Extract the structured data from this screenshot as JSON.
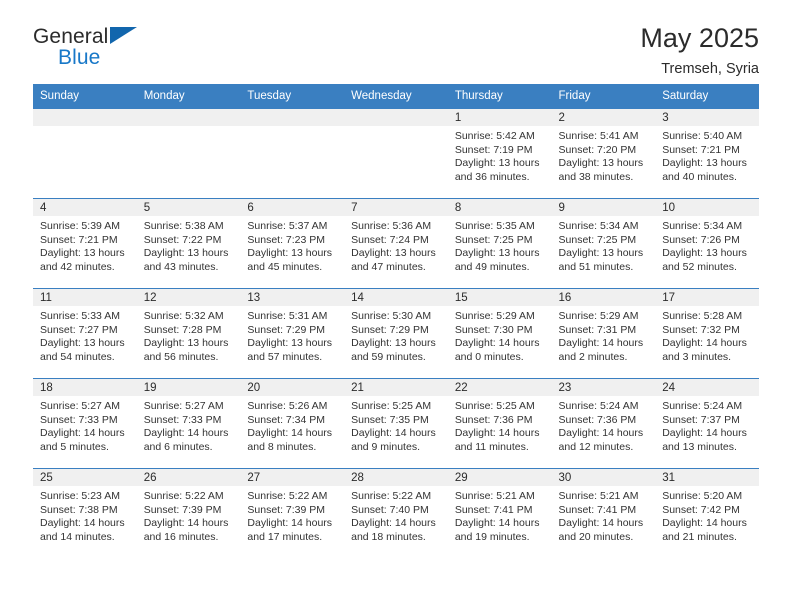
{
  "brand": {
    "word_one": "General",
    "word_two": "Blue",
    "flag_icon": "triangle-flag-icon"
  },
  "header": {
    "title": "May 2025",
    "location": "Tremseh, Syria"
  },
  "calendar": {
    "weekday_headers": [
      "Sunday",
      "Monday",
      "Tuesday",
      "Wednesday",
      "Thursday",
      "Friday",
      "Saturday"
    ],
    "accent_color": "#3a7fc1",
    "daynum_band_color": "#f0f0f0",
    "weeks": [
      [
        {
          "day": "",
          "sunrise": "",
          "sunset": "",
          "daylight_line1": "",
          "daylight_line2": ""
        },
        {
          "day": "",
          "sunrise": "",
          "sunset": "",
          "daylight_line1": "",
          "daylight_line2": ""
        },
        {
          "day": "",
          "sunrise": "",
          "sunset": "",
          "daylight_line1": "",
          "daylight_line2": ""
        },
        {
          "day": "",
          "sunrise": "",
          "sunset": "",
          "daylight_line1": "",
          "daylight_line2": ""
        },
        {
          "day": "1",
          "sunrise": "Sunrise: 5:42 AM",
          "sunset": "Sunset: 7:19 PM",
          "daylight_line1": "Daylight: 13 hours",
          "daylight_line2": "and 36 minutes."
        },
        {
          "day": "2",
          "sunrise": "Sunrise: 5:41 AM",
          "sunset": "Sunset: 7:20 PM",
          "daylight_line1": "Daylight: 13 hours",
          "daylight_line2": "and 38 minutes."
        },
        {
          "day": "3",
          "sunrise": "Sunrise: 5:40 AM",
          "sunset": "Sunset: 7:21 PM",
          "daylight_line1": "Daylight: 13 hours",
          "daylight_line2": "and 40 minutes."
        }
      ],
      [
        {
          "day": "4",
          "sunrise": "Sunrise: 5:39 AM",
          "sunset": "Sunset: 7:21 PM",
          "daylight_line1": "Daylight: 13 hours",
          "daylight_line2": "and 42 minutes."
        },
        {
          "day": "5",
          "sunrise": "Sunrise: 5:38 AM",
          "sunset": "Sunset: 7:22 PM",
          "daylight_line1": "Daylight: 13 hours",
          "daylight_line2": "and 43 minutes."
        },
        {
          "day": "6",
          "sunrise": "Sunrise: 5:37 AM",
          "sunset": "Sunset: 7:23 PM",
          "daylight_line1": "Daylight: 13 hours",
          "daylight_line2": "and 45 minutes."
        },
        {
          "day": "7",
          "sunrise": "Sunrise: 5:36 AM",
          "sunset": "Sunset: 7:24 PM",
          "daylight_line1": "Daylight: 13 hours",
          "daylight_line2": "and 47 minutes."
        },
        {
          "day": "8",
          "sunrise": "Sunrise: 5:35 AM",
          "sunset": "Sunset: 7:25 PM",
          "daylight_line1": "Daylight: 13 hours",
          "daylight_line2": "and 49 minutes."
        },
        {
          "day": "9",
          "sunrise": "Sunrise: 5:34 AM",
          "sunset": "Sunset: 7:25 PM",
          "daylight_line1": "Daylight: 13 hours",
          "daylight_line2": "and 51 minutes."
        },
        {
          "day": "10",
          "sunrise": "Sunrise: 5:34 AM",
          "sunset": "Sunset: 7:26 PM",
          "daylight_line1": "Daylight: 13 hours",
          "daylight_line2": "and 52 minutes."
        }
      ],
      [
        {
          "day": "11",
          "sunrise": "Sunrise: 5:33 AM",
          "sunset": "Sunset: 7:27 PM",
          "daylight_line1": "Daylight: 13 hours",
          "daylight_line2": "and 54 minutes."
        },
        {
          "day": "12",
          "sunrise": "Sunrise: 5:32 AM",
          "sunset": "Sunset: 7:28 PM",
          "daylight_line1": "Daylight: 13 hours",
          "daylight_line2": "and 56 minutes."
        },
        {
          "day": "13",
          "sunrise": "Sunrise: 5:31 AM",
          "sunset": "Sunset: 7:29 PM",
          "daylight_line1": "Daylight: 13 hours",
          "daylight_line2": "and 57 minutes."
        },
        {
          "day": "14",
          "sunrise": "Sunrise: 5:30 AM",
          "sunset": "Sunset: 7:29 PM",
          "daylight_line1": "Daylight: 13 hours",
          "daylight_line2": "and 59 minutes."
        },
        {
          "day": "15",
          "sunrise": "Sunrise: 5:29 AM",
          "sunset": "Sunset: 7:30 PM",
          "daylight_line1": "Daylight: 14 hours",
          "daylight_line2": "and 0 minutes."
        },
        {
          "day": "16",
          "sunrise": "Sunrise: 5:29 AM",
          "sunset": "Sunset: 7:31 PM",
          "daylight_line1": "Daylight: 14 hours",
          "daylight_line2": "and 2 minutes."
        },
        {
          "day": "17",
          "sunrise": "Sunrise: 5:28 AM",
          "sunset": "Sunset: 7:32 PM",
          "daylight_line1": "Daylight: 14 hours",
          "daylight_line2": "and 3 minutes."
        }
      ],
      [
        {
          "day": "18",
          "sunrise": "Sunrise: 5:27 AM",
          "sunset": "Sunset: 7:33 PM",
          "daylight_line1": "Daylight: 14 hours",
          "daylight_line2": "and 5 minutes."
        },
        {
          "day": "19",
          "sunrise": "Sunrise: 5:27 AM",
          "sunset": "Sunset: 7:33 PM",
          "daylight_line1": "Daylight: 14 hours",
          "daylight_line2": "and 6 minutes."
        },
        {
          "day": "20",
          "sunrise": "Sunrise: 5:26 AM",
          "sunset": "Sunset: 7:34 PM",
          "daylight_line1": "Daylight: 14 hours",
          "daylight_line2": "and 8 minutes."
        },
        {
          "day": "21",
          "sunrise": "Sunrise: 5:25 AM",
          "sunset": "Sunset: 7:35 PM",
          "daylight_line1": "Daylight: 14 hours",
          "daylight_line2": "and 9 minutes."
        },
        {
          "day": "22",
          "sunrise": "Sunrise: 5:25 AM",
          "sunset": "Sunset: 7:36 PM",
          "daylight_line1": "Daylight: 14 hours",
          "daylight_line2": "and 11 minutes."
        },
        {
          "day": "23",
          "sunrise": "Sunrise: 5:24 AM",
          "sunset": "Sunset: 7:36 PM",
          "daylight_line1": "Daylight: 14 hours",
          "daylight_line2": "and 12 minutes."
        },
        {
          "day": "24",
          "sunrise": "Sunrise: 5:24 AM",
          "sunset": "Sunset: 7:37 PM",
          "daylight_line1": "Daylight: 14 hours",
          "daylight_line2": "and 13 minutes."
        }
      ],
      [
        {
          "day": "25",
          "sunrise": "Sunrise: 5:23 AM",
          "sunset": "Sunset: 7:38 PM",
          "daylight_line1": "Daylight: 14 hours",
          "daylight_line2": "and 14 minutes."
        },
        {
          "day": "26",
          "sunrise": "Sunrise: 5:22 AM",
          "sunset": "Sunset: 7:39 PM",
          "daylight_line1": "Daylight: 14 hours",
          "daylight_line2": "and 16 minutes."
        },
        {
          "day": "27",
          "sunrise": "Sunrise: 5:22 AM",
          "sunset": "Sunset: 7:39 PM",
          "daylight_line1": "Daylight: 14 hours",
          "daylight_line2": "and 17 minutes."
        },
        {
          "day": "28",
          "sunrise": "Sunrise: 5:22 AM",
          "sunset": "Sunset: 7:40 PM",
          "daylight_line1": "Daylight: 14 hours",
          "daylight_line2": "and 18 minutes."
        },
        {
          "day": "29",
          "sunrise": "Sunrise: 5:21 AM",
          "sunset": "Sunset: 7:41 PM",
          "daylight_line1": "Daylight: 14 hours",
          "daylight_line2": "and 19 minutes."
        },
        {
          "day": "30",
          "sunrise": "Sunrise: 5:21 AM",
          "sunset": "Sunset: 7:41 PM",
          "daylight_line1": "Daylight: 14 hours",
          "daylight_line2": "and 20 minutes."
        },
        {
          "day": "31",
          "sunrise": "Sunrise: 5:20 AM",
          "sunset": "Sunset: 7:42 PM",
          "daylight_line1": "Daylight: 14 hours",
          "daylight_line2": "and 21 minutes."
        }
      ]
    ]
  }
}
